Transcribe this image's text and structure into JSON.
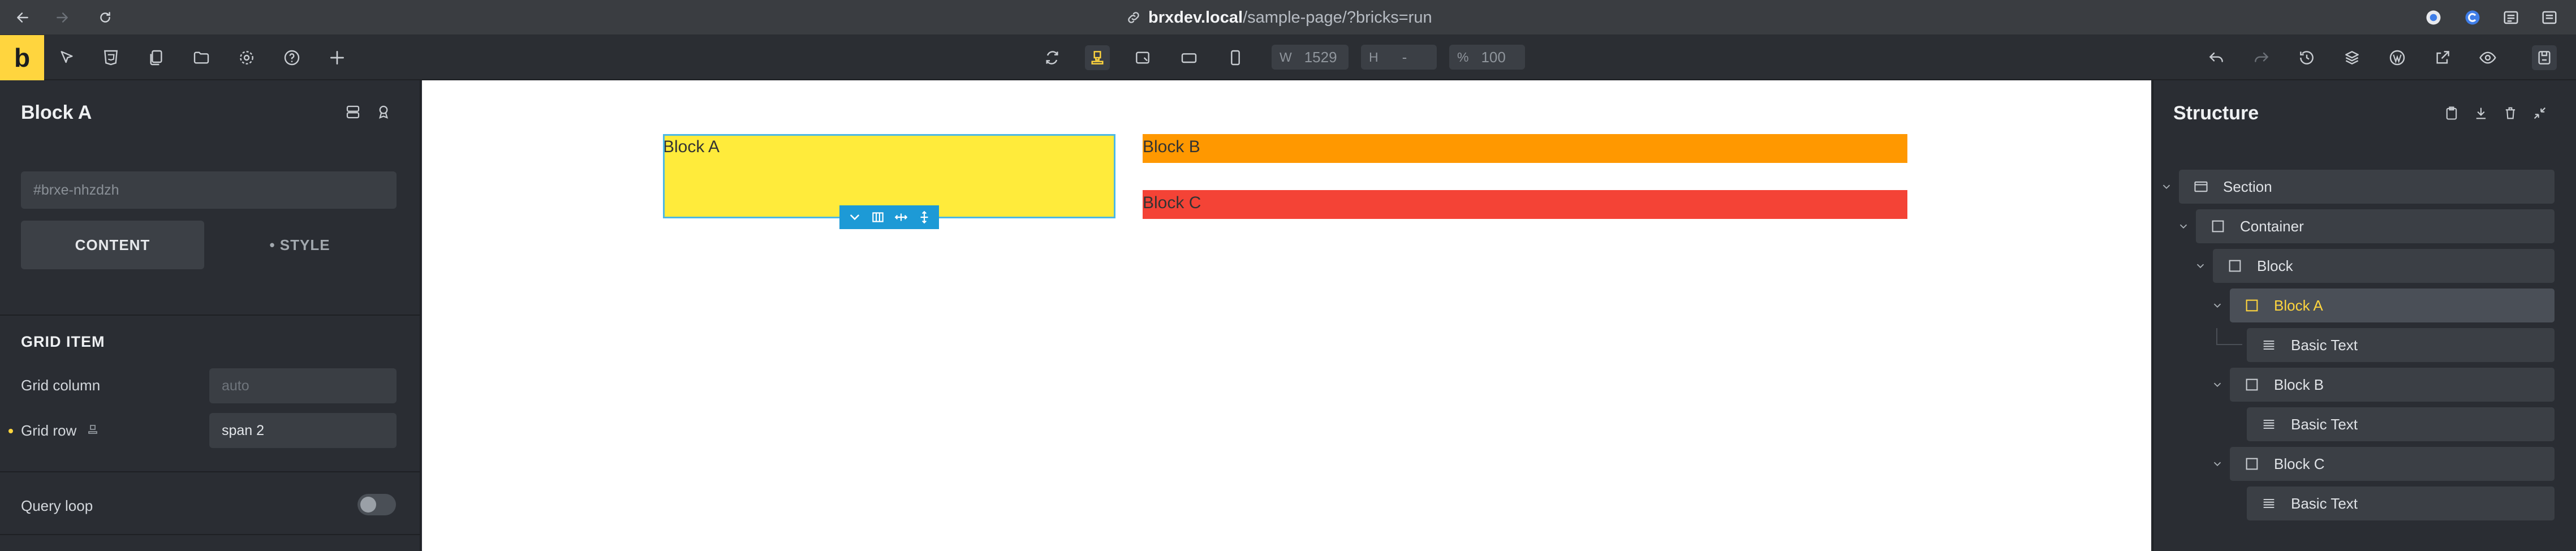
{
  "browser": {
    "url_host": "brxdev.local",
    "url_path": "/sample-page/?bricks=run"
  },
  "toolbar": {
    "logo": "b",
    "width_label": "W",
    "width_value": "1529",
    "height_label": "H",
    "height_value": "-",
    "zoom_label": "%",
    "zoom_value": "100"
  },
  "left_panel": {
    "title": "Block A",
    "element_id_placeholder": "#brxe-nhzdzh",
    "tabs": {
      "content": "CONTENT",
      "style": "• STYLE"
    },
    "section_title": "GRID ITEM",
    "fields": {
      "grid_column_label": "Grid column",
      "grid_column_placeholder": "auto",
      "grid_row_label": "Grid row",
      "grid_row_value": "span 2"
    },
    "query_loop_label": "Query loop",
    "query_loop_enabled": false
  },
  "canvas": {
    "blocks": [
      {
        "label": "Block A",
        "color": "#ffeb3b"
      },
      {
        "label": "Block B",
        "color": "#ff9800"
      },
      {
        "label": "Block C",
        "color": "#f44336"
      }
    ]
  },
  "structure": {
    "title": "Structure",
    "items": [
      {
        "label": "Section",
        "icon": "section-icon"
      },
      {
        "label": "Container",
        "icon": "container-icon"
      },
      {
        "label": "Block",
        "icon": "block-icon"
      },
      {
        "label": "Block A",
        "icon": "block-icon",
        "selected": true
      },
      {
        "label": "Basic Text",
        "icon": "text-icon"
      },
      {
        "label": "Block B",
        "icon": "block-icon"
      },
      {
        "label": "Basic Text",
        "icon": "text-icon"
      },
      {
        "label": "Block C",
        "icon": "block-icon"
      },
      {
        "label": "Basic Text",
        "icon": "text-icon"
      }
    ]
  },
  "colors": {
    "accent": "#ffd53e",
    "selection_outline": "#4cb8e5",
    "element_toolbar": "#1d9ad6"
  }
}
